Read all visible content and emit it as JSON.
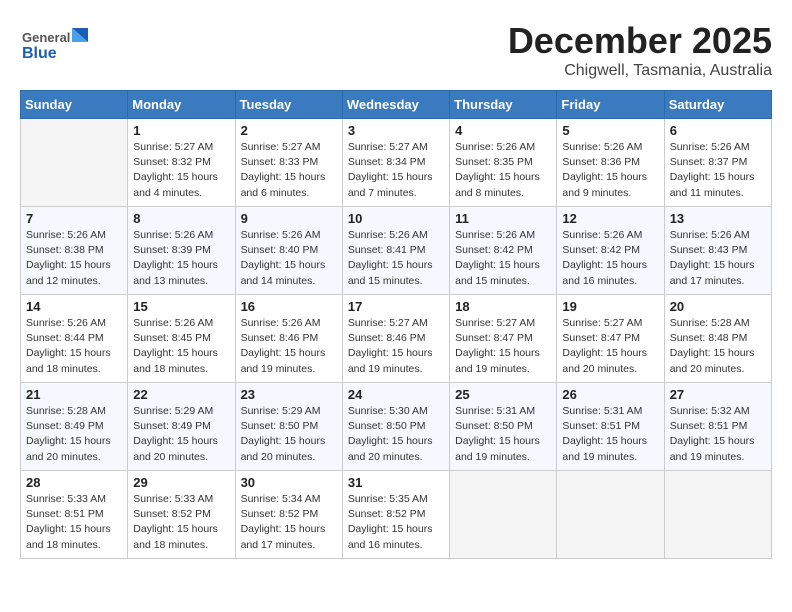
{
  "header": {
    "logo_text_general": "General",
    "logo_text_blue": "Blue",
    "month": "December 2025",
    "location": "Chigwell, Tasmania, Australia"
  },
  "days_of_week": [
    "Sunday",
    "Monday",
    "Tuesday",
    "Wednesday",
    "Thursday",
    "Friday",
    "Saturday"
  ],
  "weeks": [
    [
      {
        "day": "",
        "info": ""
      },
      {
        "day": "1",
        "info": "Sunrise: 5:27 AM\nSunset: 8:32 PM\nDaylight: 15 hours\nand 4 minutes."
      },
      {
        "day": "2",
        "info": "Sunrise: 5:27 AM\nSunset: 8:33 PM\nDaylight: 15 hours\nand 6 minutes."
      },
      {
        "day": "3",
        "info": "Sunrise: 5:27 AM\nSunset: 8:34 PM\nDaylight: 15 hours\nand 7 minutes."
      },
      {
        "day": "4",
        "info": "Sunrise: 5:26 AM\nSunset: 8:35 PM\nDaylight: 15 hours\nand 8 minutes."
      },
      {
        "day": "5",
        "info": "Sunrise: 5:26 AM\nSunset: 8:36 PM\nDaylight: 15 hours\nand 9 minutes."
      },
      {
        "day": "6",
        "info": "Sunrise: 5:26 AM\nSunset: 8:37 PM\nDaylight: 15 hours\nand 11 minutes."
      }
    ],
    [
      {
        "day": "7",
        "info": "Sunrise: 5:26 AM\nSunset: 8:38 PM\nDaylight: 15 hours\nand 12 minutes."
      },
      {
        "day": "8",
        "info": "Sunrise: 5:26 AM\nSunset: 8:39 PM\nDaylight: 15 hours\nand 13 minutes."
      },
      {
        "day": "9",
        "info": "Sunrise: 5:26 AM\nSunset: 8:40 PM\nDaylight: 15 hours\nand 14 minutes."
      },
      {
        "day": "10",
        "info": "Sunrise: 5:26 AM\nSunset: 8:41 PM\nDaylight: 15 hours\nand 15 minutes."
      },
      {
        "day": "11",
        "info": "Sunrise: 5:26 AM\nSunset: 8:42 PM\nDaylight: 15 hours\nand 15 minutes."
      },
      {
        "day": "12",
        "info": "Sunrise: 5:26 AM\nSunset: 8:42 PM\nDaylight: 15 hours\nand 16 minutes."
      },
      {
        "day": "13",
        "info": "Sunrise: 5:26 AM\nSunset: 8:43 PM\nDaylight: 15 hours\nand 17 minutes."
      }
    ],
    [
      {
        "day": "14",
        "info": "Sunrise: 5:26 AM\nSunset: 8:44 PM\nDaylight: 15 hours\nand 18 minutes."
      },
      {
        "day": "15",
        "info": "Sunrise: 5:26 AM\nSunset: 8:45 PM\nDaylight: 15 hours\nand 18 minutes."
      },
      {
        "day": "16",
        "info": "Sunrise: 5:26 AM\nSunset: 8:46 PM\nDaylight: 15 hours\nand 19 minutes."
      },
      {
        "day": "17",
        "info": "Sunrise: 5:27 AM\nSunset: 8:46 PM\nDaylight: 15 hours\nand 19 minutes."
      },
      {
        "day": "18",
        "info": "Sunrise: 5:27 AM\nSunset: 8:47 PM\nDaylight: 15 hours\nand 19 minutes."
      },
      {
        "day": "19",
        "info": "Sunrise: 5:27 AM\nSunset: 8:47 PM\nDaylight: 15 hours\nand 20 minutes."
      },
      {
        "day": "20",
        "info": "Sunrise: 5:28 AM\nSunset: 8:48 PM\nDaylight: 15 hours\nand 20 minutes."
      }
    ],
    [
      {
        "day": "21",
        "info": "Sunrise: 5:28 AM\nSunset: 8:49 PM\nDaylight: 15 hours\nand 20 minutes."
      },
      {
        "day": "22",
        "info": "Sunrise: 5:29 AM\nSunset: 8:49 PM\nDaylight: 15 hours\nand 20 minutes."
      },
      {
        "day": "23",
        "info": "Sunrise: 5:29 AM\nSunset: 8:50 PM\nDaylight: 15 hours\nand 20 minutes."
      },
      {
        "day": "24",
        "info": "Sunrise: 5:30 AM\nSunset: 8:50 PM\nDaylight: 15 hours\nand 20 minutes."
      },
      {
        "day": "25",
        "info": "Sunrise: 5:31 AM\nSunset: 8:50 PM\nDaylight: 15 hours\nand 19 minutes."
      },
      {
        "day": "26",
        "info": "Sunrise: 5:31 AM\nSunset: 8:51 PM\nDaylight: 15 hours\nand 19 minutes."
      },
      {
        "day": "27",
        "info": "Sunrise: 5:32 AM\nSunset: 8:51 PM\nDaylight: 15 hours\nand 19 minutes."
      }
    ],
    [
      {
        "day": "28",
        "info": "Sunrise: 5:33 AM\nSunset: 8:51 PM\nDaylight: 15 hours\nand 18 minutes."
      },
      {
        "day": "29",
        "info": "Sunrise: 5:33 AM\nSunset: 8:52 PM\nDaylight: 15 hours\nand 18 minutes."
      },
      {
        "day": "30",
        "info": "Sunrise: 5:34 AM\nSunset: 8:52 PM\nDaylight: 15 hours\nand 17 minutes."
      },
      {
        "day": "31",
        "info": "Sunrise: 5:35 AM\nSunset: 8:52 PM\nDaylight: 15 hours\nand 16 minutes."
      },
      {
        "day": "",
        "info": ""
      },
      {
        "day": "",
        "info": ""
      },
      {
        "day": "",
        "info": ""
      }
    ]
  ]
}
